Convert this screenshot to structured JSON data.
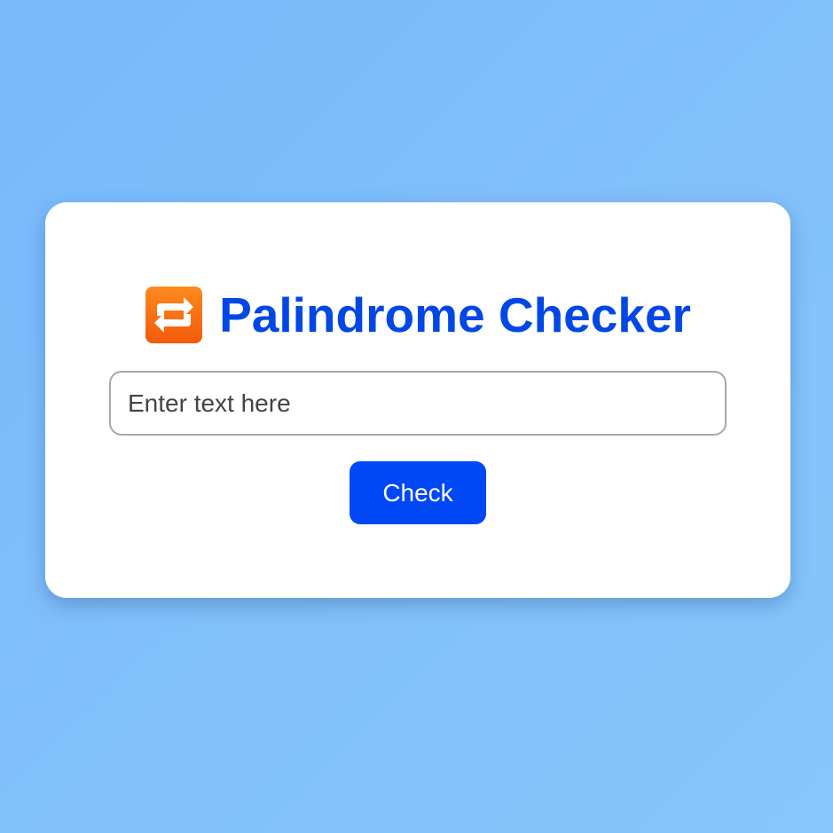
{
  "app": {
    "title_icon": "repeat-arrows-icon",
    "title": "Palindrome Checker"
  },
  "input": {
    "placeholder": "Enter text here",
    "value": ""
  },
  "button": {
    "label": "Check"
  },
  "colors": {
    "background": "#80bffb",
    "card": "#ffffff",
    "title": "#0047e6",
    "button": "#0047f5",
    "icon": "#ff6d12"
  }
}
